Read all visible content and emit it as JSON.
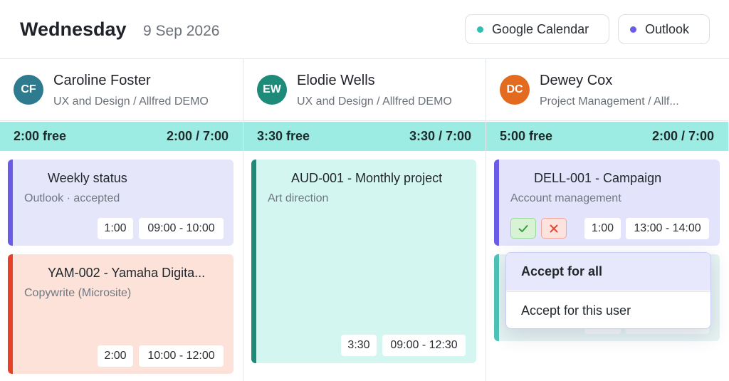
{
  "header": {
    "day": "Wednesday",
    "date": "9 Sep 2026",
    "calendars": [
      {
        "label": "Google Calendar",
        "color": "#2ebfb0"
      },
      {
        "label": "Outlook",
        "color": "#6b5ce7"
      }
    ]
  },
  "columns": [
    {
      "user": {
        "initials": "CF",
        "name": "Caroline Foster",
        "team": "UX and Design / Allfred DEMO",
        "avatar_color": "#2e7a8f"
      },
      "free": "2:00 free",
      "ratio": "2:00 / 7:00",
      "events": [
        {
          "title": "Weekly status",
          "subtitle": "Outlook · accepted",
          "duration": "1:00",
          "time": "09:00 - 10:00",
          "bg": "#e6e6fb",
          "bar": "#6b5ce7"
        },
        {
          "title": "YAM-002 - Yamaha Digita...",
          "subtitle": "Copywrite (Microsite)",
          "duration": "2:00",
          "time": "10:00 - 12:00",
          "bg": "#fde2da",
          "bar": "#e8412a"
        }
      ]
    },
    {
      "user": {
        "initials": "EW",
        "name": "Elodie Wells",
        "team": "UX and Design / Allfred DEMO",
        "avatar_color": "#1e8a7a"
      },
      "free": "3:30 free",
      "ratio": "3:30 / 7:00",
      "events": [
        {
          "title": "AUD-001 - Monthly project",
          "subtitle": "Art direction",
          "duration": "3:30",
          "time": "09:00 - 12:30",
          "bg": "#d3f6f1",
          "bar": "#1e8a7a"
        }
      ]
    },
    {
      "user": {
        "initials": "DC",
        "name": "Dewey Cox",
        "team": "Project Management / Allf...",
        "avatar_color": "#e26b1f"
      },
      "free": "5:00 free",
      "ratio": "2:00 / 7:00",
      "events": [
        {
          "title": "DELL-001 - Campaign",
          "subtitle": "Account management",
          "duration": "1:00",
          "time": "13:00 - 14:00",
          "bg": "#e3e4fb",
          "bar": "#6b5ce7"
        }
      ]
    }
  ],
  "actions": {
    "accept_icon": "check-icon",
    "decline_icon": "x-icon"
  },
  "popup": {
    "options": [
      "Accept for all",
      "Accept for this user"
    ]
  }
}
